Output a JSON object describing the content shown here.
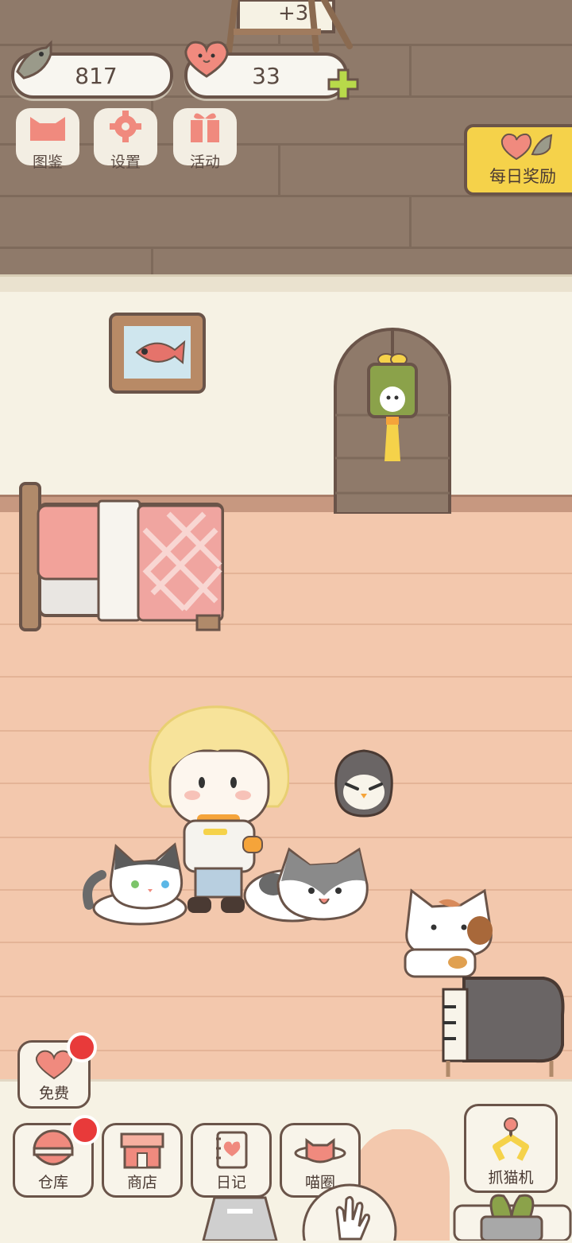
{
  "hud": {
    "fish_count": "817",
    "heart_count": "33",
    "bonus": "+3",
    "daily_reward_label": "每日奖励"
  },
  "menu": {
    "collection_label": "图鉴",
    "settings_label": "设置",
    "events_label": "活动"
  },
  "bottom": {
    "free_label": "免费",
    "warehouse_label": "仓库",
    "shop_label": "商店",
    "diary_label": "日记",
    "circle_label": "喵圈",
    "claw_machine_label": "抓猫机"
  },
  "colors": {
    "accent_yellow": "#f5d24a",
    "heart_pink": "#f08a7e",
    "notification_red": "#e83a3a",
    "outline_brown": "#6a5449",
    "plus_green": "#b8d94a"
  }
}
